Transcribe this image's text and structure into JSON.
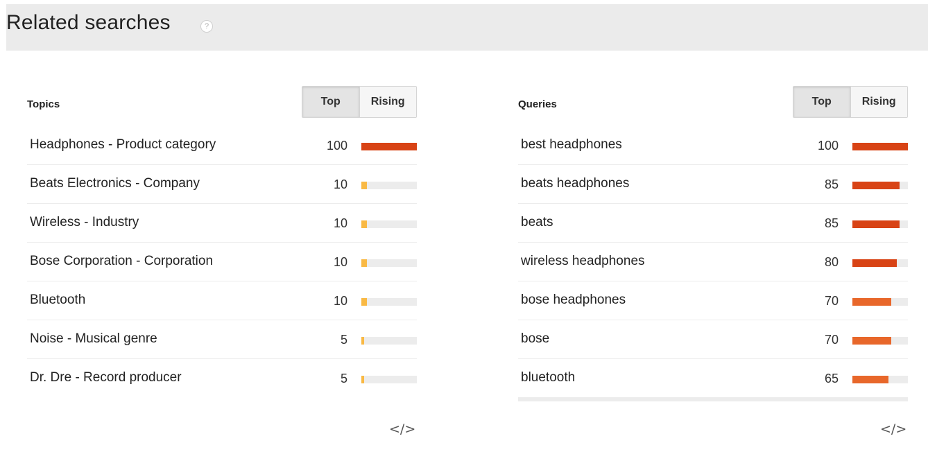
{
  "header": {
    "title": "Related searches",
    "help_icon": "?"
  },
  "topics": {
    "label": "Topics",
    "toggle": {
      "top": "Top",
      "rising": "Rising",
      "selected": "Top"
    },
    "rows": [
      {
        "name": "Headphones - Product category",
        "value": 100,
        "color": "#d84315"
      },
      {
        "name": "Beats Electronics - Company",
        "value": 10,
        "color": "#f9b944"
      },
      {
        "name": "Wireless - Industry",
        "value": 10,
        "color": "#f9b944"
      },
      {
        "name": "Bose Corporation - Corporation",
        "value": 10,
        "color": "#f9b944"
      },
      {
        "name": "Bluetooth",
        "value": 10,
        "color": "#f9b944"
      },
      {
        "name": "Noise - Musical genre",
        "value": 5,
        "color": "#f9b944"
      },
      {
        "name": "Dr. Dre - Record producer",
        "value": 5,
        "color": "#f9b944"
      }
    ],
    "embed_icon": "</>"
  },
  "queries": {
    "label": "Queries",
    "toggle": {
      "top": "Top",
      "rising": "Rising",
      "selected": "Top"
    },
    "rows": [
      {
        "name": "best headphones",
        "value": 100,
        "color": "#d84315"
      },
      {
        "name": "beats headphones",
        "value": 85,
        "color": "#d84315"
      },
      {
        "name": "beats",
        "value": 85,
        "color": "#d84315"
      },
      {
        "name": "wireless headphones",
        "value": 80,
        "color": "#d84315"
      },
      {
        "name": "bose headphones",
        "value": 70,
        "color": "#e8672a"
      },
      {
        "name": "bose",
        "value": 70,
        "color": "#e8672a"
      },
      {
        "name": "bluetooth",
        "value": 65,
        "color": "#e8672a"
      }
    ],
    "embed_icon": "</>"
  }
}
